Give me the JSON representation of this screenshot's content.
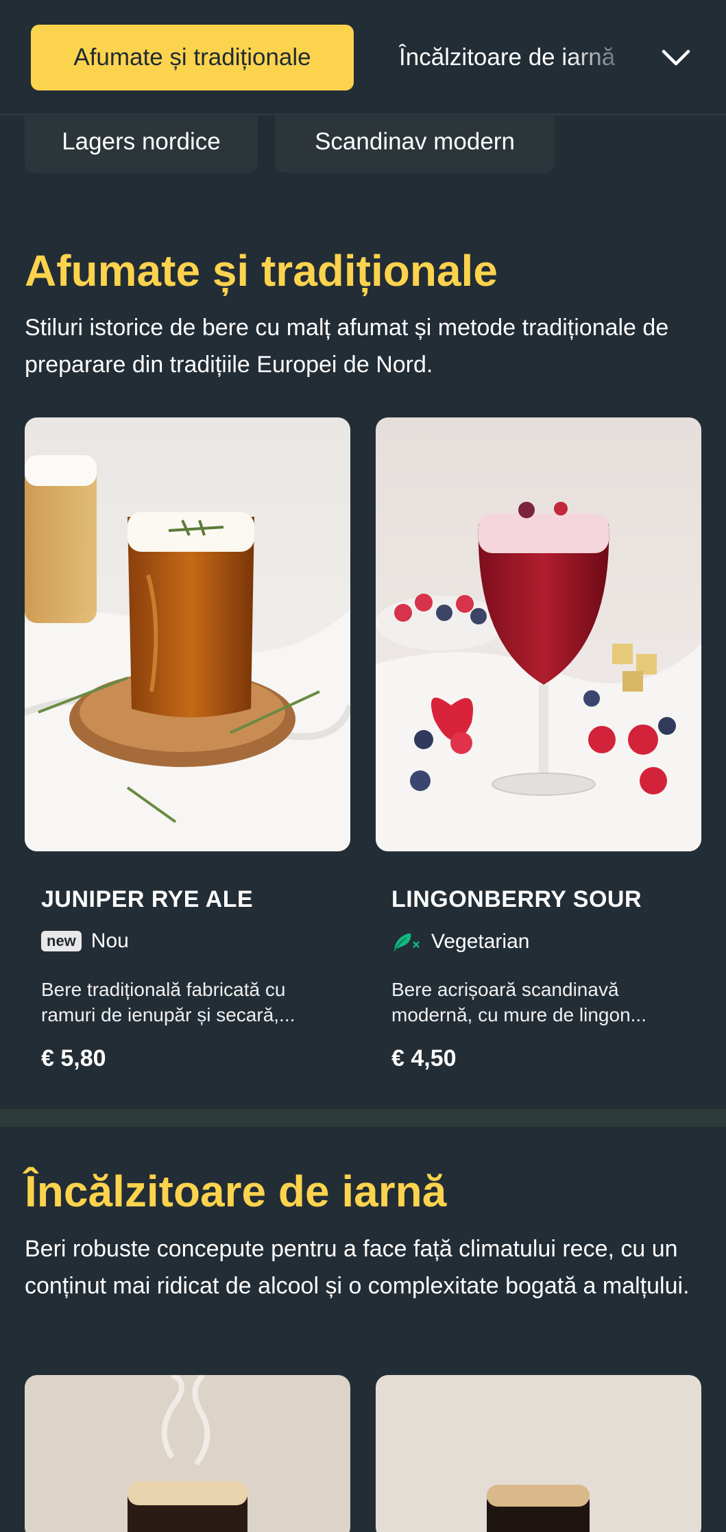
{
  "tabs": {
    "active": "Afumate și tradiționale",
    "next": "Încălzitoare de iarnă",
    "chips": [
      "Lagers nordice",
      "Scandinav modern"
    ]
  },
  "icons": {
    "expand": "chevron-down-icon",
    "vegetarian": "vegetarian-leaf-icon"
  },
  "colors": {
    "accent": "#fcd34d",
    "background": "#232d35",
    "vegetarian": "#10b981"
  },
  "sections": [
    {
      "title": "Afumate și tradiționale",
      "description": "Stiluri istorice de bere cu malț afumat și metode tradiționale de preparare din tradițiile Europei de Nord.",
      "items": [
        {
          "name": "JUNIPER RYE ALE",
          "badge": "new",
          "tag": "Nou",
          "description": "Bere tradițională fabricată cu ramuri de ienupăr și secară,...",
          "price": "€ 5,80"
        },
        {
          "name": "LINGONBERRY SOUR",
          "tag": "Vegetarian",
          "description": "Bere acrișoară scandinavă modernă, cu mure de lingon...",
          "price": "€ 4,50"
        }
      ]
    },
    {
      "title": "Încălzitoare de iarnă",
      "description": "Beri robuste concepute pentru a face față climatului rece, cu un conținut mai ridicat de alcool și o complexitate bogată a malțului."
    }
  ]
}
